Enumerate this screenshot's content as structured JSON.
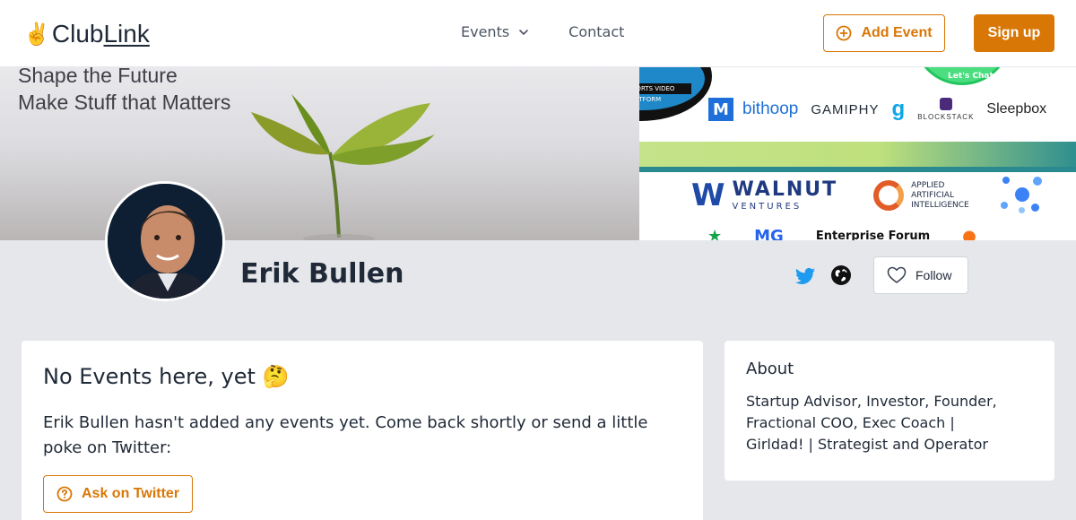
{
  "header": {
    "logo_emoji": "✌️",
    "logo_club": "Club",
    "logo_link": "Link",
    "nav": [
      {
        "label": "Events",
        "has_dropdown": true
      },
      {
        "label": "Contact",
        "has_dropdown": false
      }
    ],
    "add_event_label": "Add Event",
    "sign_up_label": "Sign up"
  },
  "banner": {
    "tagline_line1": "Shape the Future",
    "tagline_line2": "Make Stuff that Matters",
    "badge_caption": "THE SPORTS VIDEO PLATFORM",
    "badge_chat": "Let's Chat",
    "sponsors_row1": [
      "bithoop",
      "GAMIPHY",
      "BLOCKSTACK",
      "Sleepbox"
    ],
    "sponsor_walnut": "WALNUT",
    "sponsor_walnut_sub": "VENTURES",
    "sponsor_ai": "APPLIED ARTIFICIAL INTELLIGENCE",
    "sponsor_forum": "Enterprise Forum"
  },
  "profile": {
    "name": "Erik Bullen",
    "follow_label": "Follow"
  },
  "events_card": {
    "title": "No Events here, yet",
    "title_emoji": "🤔",
    "message": "Erik Bullen hasn't added any events yet. Come back shortly or send a little poke on Twitter:",
    "ask_button_label": "Ask on Twitter"
  },
  "about_card": {
    "title": "About",
    "text": "Startup Advisor, Investor, Founder, Fractional COO, Exec Coach | Girldad! | Strategist and Operator"
  },
  "colors": {
    "accent": "#d97706",
    "page_bg": "#e5e7eb",
    "twitter": "#1d9bf0"
  },
  "icons": [
    "chevron-down-icon",
    "plus-circle-icon",
    "twitter-icon",
    "globe-icon",
    "heart-icon",
    "question-circle-icon"
  ]
}
